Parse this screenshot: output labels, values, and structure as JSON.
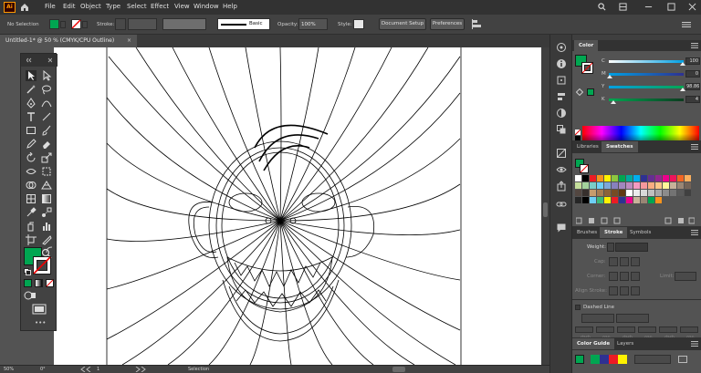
{
  "menubar": {
    "items": [
      "File",
      "Edit",
      "Object",
      "Type",
      "Select",
      "Effect",
      "View",
      "Window",
      "Help"
    ],
    "logo": "Ai"
  },
  "control": {
    "selection_label": "No Selection",
    "stroke_label": "Stroke:",
    "brush_label": "Basic",
    "opacity_label": "Opacity:",
    "opacity_value": "100%",
    "style_label": "Style:",
    "doc_setup": "Document Setup",
    "preferences": "Preferences"
  },
  "tab": {
    "title": "Untitled-1* @ 50 % (CMYK/CPU Outline)",
    "close": "×"
  },
  "status": {
    "zoom": "50%",
    "rotate": "0°",
    "artboard": "1",
    "tool": "Selection"
  },
  "color_panel": {
    "title": "Color",
    "sliders": [
      {
        "label": "C",
        "value": "100",
        "pos": 0.98,
        "color_from": "#ffffff",
        "color_to": "#00a0e3"
      },
      {
        "label": "M",
        "value": "0",
        "pos": 0.98,
        "color_from": "#ffffff",
        "color_to": "#e4007f"
      },
      {
        "label": "Y",
        "value": "98.86",
        "pos": 0.98,
        "color_from": "#00a37f",
        "color_to": "#1a7f3a"
      },
      {
        "label": "K",
        "value": "4",
        "pos": 0.98,
        "color_from": "#2fa36a",
        "color_to": "#0c3b1f"
      }
    ],
    "fill_color": "#00a651"
  },
  "swatch_panel": {
    "tabs": [
      "Libraries",
      "Swatches"
    ]
  },
  "stroke_panel": {
    "tabs": [
      "Brushes",
      "Stroke",
      "Symbols"
    ],
    "weight_label": "Weight:",
    "cap_label": "Cap:",
    "corner_label": "Corner:",
    "limit_label": "Limit:",
    "align_label": "Align Stroke:",
    "dashed_label": "Dashed Line",
    "dash_labels": [
      "dash",
      "gap",
      "dash",
      "gap",
      "dash",
      "gap"
    ]
  },
  "guide_panel": {
    "tabs": [
      "Color Guide",
      "Layers"
    ]
  },
  "colors": {
    "fill": "#00a651",
    "swatch_rows": [
      [
        "#ffffff",
        "#000000",
        "#ed1c24",
        "#f7941d",
        "#fff200",
        "#8dc63f",
        "#00a651",
        "#00a99d",
        "#00aeef",
        "#2e3192",
        "#662d91",
        "#92278f",
        "#ec008c",
        "#ed145b",
        "#f26522",
        "#fbaf5d"
      ],
      [
        "#c4df9b",
        "#a3d39c",
        "#7accc8",
        "#6dcff6",
        "#7da7d9",
        "#8781bd",
        "#a186be",
        "#bd8cbf",
        "#f49ac1",
        "#f5989d",
        "#f9ad81",
        "#fdc689",
        "#fff799",
        "#c7b299",
        "#998675",
        "#736357"
      ],
      [
        "#534741",
        "#37302d",
        "#c69c6d",
        "#a67c52",
        "#8c6239",
        "#754c24",
        "#603913",
        "#ffffff",
        "#ebebeb",
        "#d9d9d9",
        "#bfbfbf",
        "#a6a6a6",
        "#8c8c8c",
        "#737373",
        "#595959",
        "#404040"
      ],
      [
        "#262626",
        "#000000",
        "#6dcff6",
        "#3cb878",
        "#fff200",
        "#ed1c24",
        "#2e3192",
        "#ec008c",
        "#c7b299",
        "#998675",
        "#00a651",
        "#f7941d"
      ]
    ]
  }
}
